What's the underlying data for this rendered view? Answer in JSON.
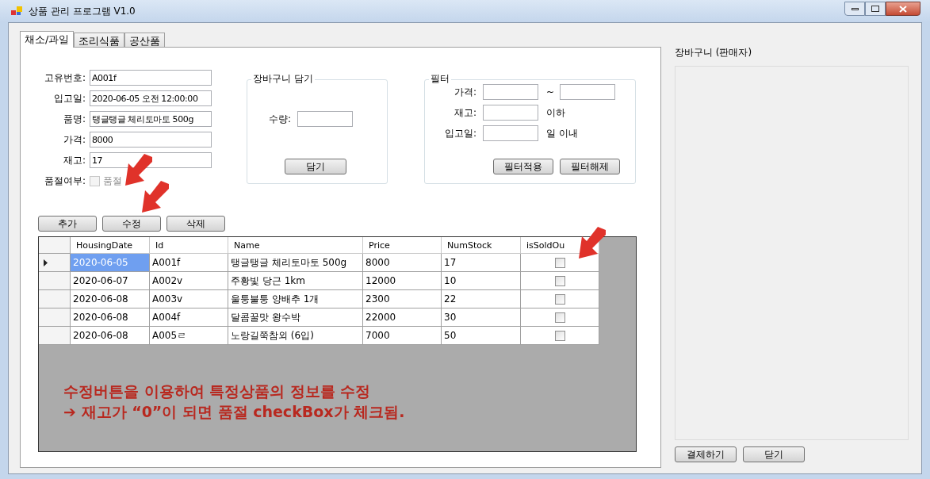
{
  "window": {
    "title": "상품 관리 프로그램 V1.0"
  },
  "tabs": [
    {
      "label": "채소/과일",
      "selected": true
    },
    {
      "label": "조리식품",
      "selected": false
    },
    {
      "label": "공산품",
      "selected": false
    }
  ],
  "form": {
    "fields": [
      {
        "label": "고유번호:",
        "value": "A001f"
      },
      {
        "label": "입고일:",
        "value": "2020-06-05 오전 12:00:00"
      },
      {
        "label": "품명:",
        "value": "탱글탱글 체리토마토 500g"
      },
      {
        "label": "가격:",
        "value": "8000"
      },
      {
        "label": "재고:",
        "value": "17"
      }
    ],
    "sold_out": {
      "label": "품절여부:",
      "text": "품절",
      "checked": false,
      "disabled": true
    },
    "buttons": [
      "추가",
      "수정",
      "삭제"
    ]
  },
  "cart_group": {
    "title": "장바구니 담기",
    "quantity_label": "수량:",
    "button": "담기"
  },
  "filter_group": {
    "title": "필터",
    "price_label": "가격:",
    "range_sep": "~",
    "stock_label": "재고:",
    "stock_suffix": "이하",
    "date_label": "입고일:",
    "date_suffix": "일 이내",
    "buttons": [
      "필터적용",
      "필터해제"
    ]
  },
  "table": {
    "columns": [
      "HousingDate",
      "Id",
      "Name",
      "Price",
      "NumStock",
      "isSoldOu"
    ],
    "rows": [
      {
        "selected": true,
        "cells": [
          "2020-06-05",
          "A001f",
          "탱글탱글 체리토마토 500g",
          "8000",
          "17"
        ],
        "sold_out": false
      },
      {
        "selected": false,
        "cells": [
          "2020-06-07",
          "A002v",
          "주황빛 당근 1km",
          "12000",
          "10"
        ],
        "sold_out": false
      },
      {
        "selected": false,
        "cells": [
          "2020-06-08",
          "A003v",
          "울퉁불퉁 양배추 1개",
          "2300",
          "22"
        ],
        "sold_out": false
      },
      {
        "selected": false,
        "cells": [
          "2020-06-08",
          "A004f",
          "달콤꿀맛 왕수박",
          "22000",
          "30"
        ],
        "sold_out": false
      },
      {
        "selected": false,
        "cells": [
          "2020-06-08",
          "A005ㄹ",
          "노랑길쭉참외 (6입)",
          "7000",
          "50"
        ],
        "sold_out": false
      }
    ]
  },
  "annotation": [
    "수정버튼을 이용하여 특정상품의 정보를 수정",
    "➔ 재고가 “0”이 되면 품절 checkBox가 체크됨."
  ],
  "cart_panel": {
    "title": "장바구니 (판매자)",
    "buttons": [
      "결제하기",
      "닫기"
    ]
  }
}
